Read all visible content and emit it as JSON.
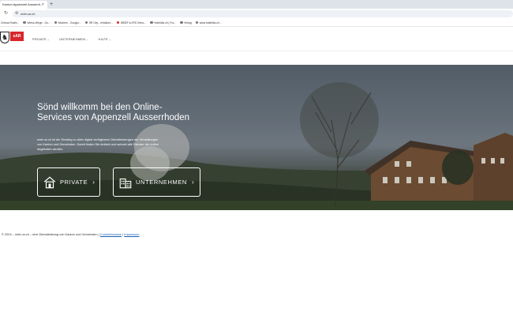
{
  "browser": {
    "tab_title": "Kanton Appenzell Ausserrh...",
    "tab_close": "×",
    "new_tab": "+",
    "url": "mein.ar.ch",
    "bookmarks": [
      "Chinsa Ruteb...",
      "Weiss-Wege - Go...",
      "Muchen - Googlo...",
      "SR City - mindluer...",
      "WEBF to IRS Geno...",
      "Hotelidis.ch | Fur...",
      "Verlag",
      "www.hotelidis.ch..."
    ]
  },
  "header": {
    "logo_text": "eAR",
    "nav": [
      {
        "label": "PRIVATE"
      },
      {
        "label": "UNTERNEHMEN"
      },
      {
        "label": "HILFE"
      }
    ]
  },
  "hero": {
    "title": "Sönd willkomm bei den Online-Services von Appenzell Ausserrhoden",
    "text": "mein.ar.ch ist der Einstieg zu allen digital verfügbaren Dienstleistungen der Verwaltungen von Kanton und Gemeinden. Damit finden Sie einfach und schnell alle Dienste, die online angeboten werden.",
    "buttons": [
      {
        "label": "PRIVATE",
        "icon": "house-icon"
      },
      {
        "label": "UNTERNEHMEN",
        "icon": "buildings-icon"
      }
    ]
  },
  "footer": {
    "text": "© 2024 – mein.ar.ch – eine Dienstleistung von Kanton und Gemeinden |",
    "cookie_link": "Cookiehinweise",
    "separator": "|",
    "imprint_link": "Impressum"
  },
  "colors": {
    "brand_red": "#d9262c",
    "link": "#1a5fb4"
  }
}
